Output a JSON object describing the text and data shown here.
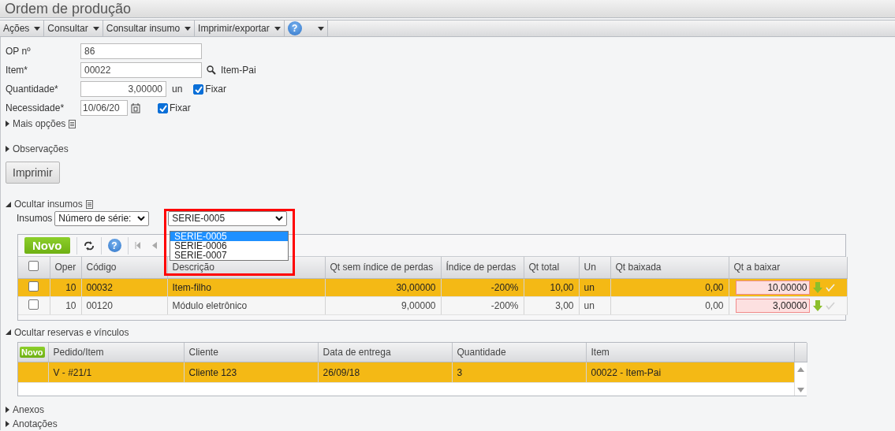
{
  "title": "Ordem de produção",
  "menu": [
    {
      "kind": "menu",
      "label": "Ações"
    },
    {
      "kind": "menu",
      "label": "Consultar"
    },
    {
      "kind": "menu",
      "label": "Consultar insumo"
    },
    {
      "kind": "menu",
      "label": "Imprimir/exportar"
    },
    {
      "kind": "help"
    }
  ],
  "form": {
    "op": {
      "label": "OP nº",
      "value": "86"
    },
    "item": {
      "label": "Item*",
      "value": "00022",
      "description": "Item-Pai"
    },
    "quantidade": {
      "label": "Quantidade*",
      "value": "3,00000",
      "unit": "un",
      "fixar": {
        "label": "Fixar",
        "checked": true
      }
    },
    "necessidade": {
      "label": "Necessidade*",
      "value": "10/06/20",
      "fixar": {
        "label": "Fixar",
        "checked": true
      }
    }
  },
  "sections_top": [
    {
      "label": "Mais opções",
      "expanded": false,
      "has_icon": true
    },
    {
      "label": "Observações",
      "expanded": false,
      "has_icon": false
    }
  ],
  "help_mark": "?",
  "print_button": "Imprimir",
  "insumos": {
    "toggle": {
      "label": "Ocultar insumos",
      "expanded": true
    },
    "filter_label": "Insumos",
    "filter_type": "Número de série:",
    "serial_select": {
      "value": "SERIE-0005",
      "options": [
        {
          "label": "SERIE-0005",
          "selected": true
        },
        {
          "label": "SERIE-0006",
          "selected": false
        },
        {
          "label": "SERIE-0007",
          "selected": false
        }
      ]
    },
    "new_button": "Novo",
    "header_checked": false,
    "columns": [
      {
        "label": "Oper",
        "kind": "number"
      },
      {
        "label": "Código",
        "kind": "text"
      },
      {
        "label": "Descrição",
        "kind": "text"
      },
      {
        "label": "Qt sem índice de perdas",
        "kind": "number"
      },
      {
        "label": "Índice de perdas",
        "kind": "number"
      },
      {
        "label": "Qt total",
        "kind": "number"
      },
      {
        "label": "Un",
        "kind": "text"
      },
      {
        "label": "Qt baixada",
        "kind": "number"
      },
      {
        "label": "Qt a baixar",
        "kind": "input"
      }
    ],
    "rows": [
      {
        "selected": true,
        "checked": false,
        "cells": [
          "10",
          "00032",
          "Item-filho",
          "30,00000",
          "-200%",
          "10,00",
          "un",
          "0,00",
          "10,00000"
        ]
      },
      {
        "selected": false,
        "checked": false,
        "cells": [
          "10",
          "00120",
          "Módulo eletrônico",
          "9,00000",
          "-200%",
          "3,00",
          "un",
          "0,00",
          "3,00000"
        ]
      }
    ]
  },
  "reservas": {
    "toggle": {
      "label": "Ocultar reservas e vínculos",
      "expanded": true
    },
    "new_button": "Novo",
    "columns": [
      "Pedido/Item",
      "Cliente",
      "Data de entrega",
      "Quantidade",
      "Item"
    ],
    "rows": [
      {
        "selected": true,
        "cells": [
          "V - #21/1",
          "Cliente 123",
          "26/09/18",
          "3",
          "00022 - Item-Pai"
        ]
      }
    ]
  },
  "sections_bottom": [
    {
      "label": "Anexos",
      "expanded": false
    },
    {
      "label": "Anotações",
      "expanded": false
    }
  ]
}
